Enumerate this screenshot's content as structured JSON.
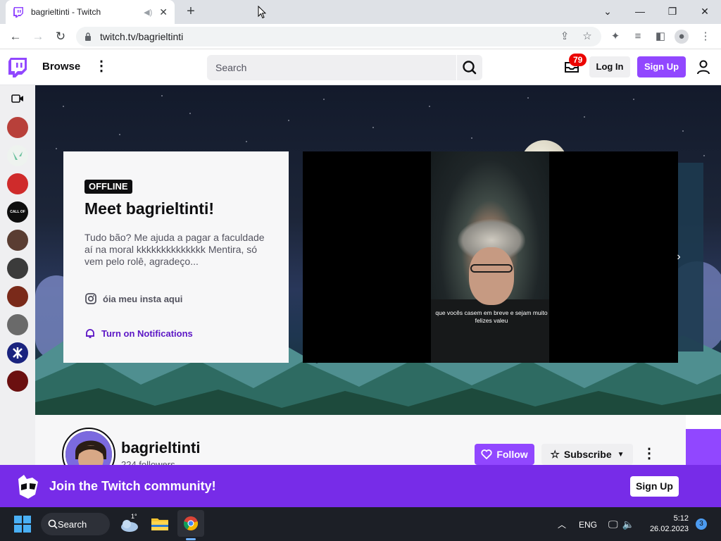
{
  "browser": {
    "tab_title": "bagrieltinti - Twitch",
    "url": "twitch.tv/bagrieltinti",
    "new_tab_symbol": "+",
    "window_controls": [
      "minimize",
      "restore",
      "close"
    ]
  },
  "twitch_nav": {
    "browse_label": "Browse",
    "search_placeholder": "Search",
    "inbox_badge": "79",
    "login_label": "Log In",
    "signup_label": "Sign Up",
    "accent": "#9147ff"
  },
  "sidebar": {
    "channels": [
      {
        "color": "#b8403a"
      },
      {
        "color": "#a7d3c0"
      },
      {
        "color": "#cf2b2b"
      },
      {
        "color": "#0e0e0e"
      },
      {
        "color": "#5a3d32"
      },
      {
        "color": "#3b3b3b"
      },
      {
        "color": "#7a2a1a"
      },
      {
        "color": "#6a6a6a"
      },
      {
        "color": "#1a237e"
      },
      {
        "color": "#6b1010"
      }
    ],
    "callofduty_label": "CALL OF DUTY"
  },
  "about": {
    "status": "OFFLINE",
    "heading": "Meet bagrieltinti!",
    "description": "Tudo bão? Me ajuda a pagar a faculdade aí na moral kkkkkkkkkkkkkk Mentira, só vem pelo rolê, agradeço...",
    "instagram_label": "óia meu insta aqui",
    "notifications_label": "Turn on Notifications"
  },
  "video": {
    "caption": "que vocês casem em breve e sejam muito felizes valeu"
  },
  "channel": {
    "name": "bagrieltinti",
    "followers": "224 followers",
    "follow_label": "Follow",
    "subscribe_label": "Subscribe"
  },
  "join_banner": {
    "text": "Join the Twitch community!",
    "signup_label": "Sign Up"
  },
  "taskbar": {
    "search_label": "Search",
    "weather_temp": "1°",
    "language": "ENG",
    "time": "5:12",
    "date": "26.02.2023",
    "notification_count": "3"
  }
}
